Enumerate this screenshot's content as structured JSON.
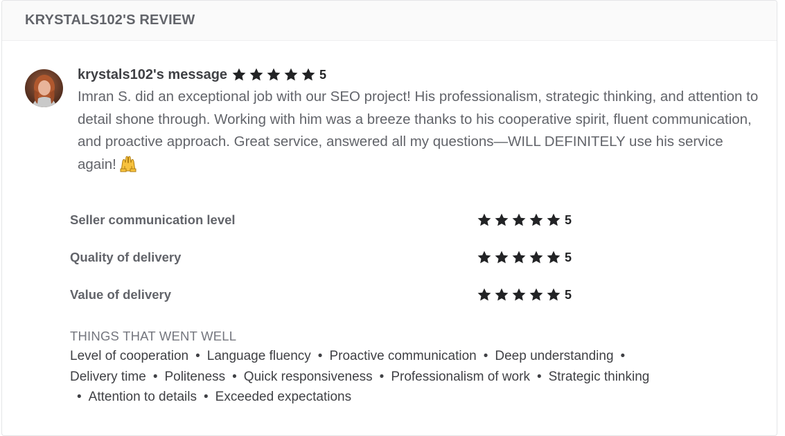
{
  "card": {
    "title": "KRYSTALS102'S REVIEW"
  },
  "message": {
    "user_label": "krystals102's message",
    "rating": "5",
    "text": "Imran S. did an exceptional job with our SEO project! His professionalism, strategic thinking, and attention to detail shone through. Working with him was a breeze thanks to his cooperative spirit, fluent communication, and proactive approach. Great service, answered all my questions—WILL DEFINITELY use his service again!",
    "emoji": "raising-hands-emoji"
  },
  "ratings": [
    {
      "label": "Seller communication level",
      "value": "5",
      "stars": 5
    },
    {
      "label": "Quality of delivery",
      "value": "5",
      "stars": 5
    },
    {
      "label": "Value of delivery",
      "value": "5",
      "stars": 5
    }
  ],
  "went_well": {
    "title": "THINGS THAT WENT WELL",
    "tags": [
      "Level of cooperation",
      "Language fluency",
      "Proactive communication",
      "Deep understanding",
      "Delivery time",
      "Politeness",
      "Quick responsiveness",
      "Professionalism of work",
      "Strategic thinking",
      "Attention to details",
      "Exceeded expectations"
    ]
  },
  "colors": {
    "star": "#222325",
    "text": "#62646a",
    "heading": "#404145",
    "header_bg": "#fafafa"
  },
  "icons": {
    "star": "star-icon",
    "avatar": "avatar"
  }
}
